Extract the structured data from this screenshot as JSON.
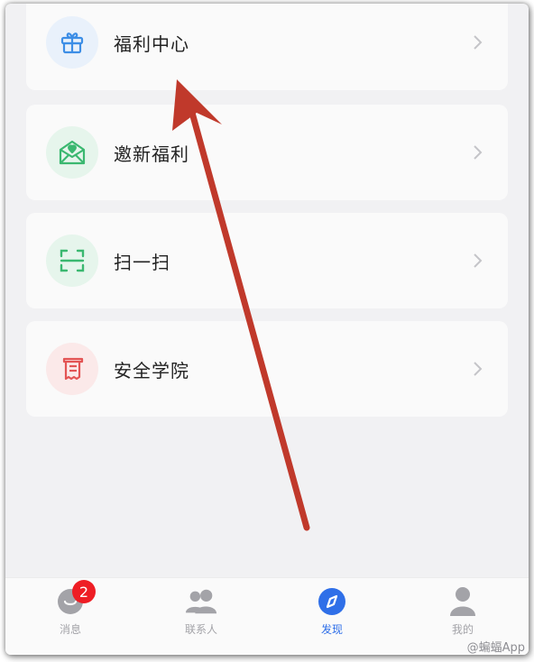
{
  "menu": {
    "items": [
      {
        "label": "福利中心",
        "icon": "gift-icon",
        "bg": "#e9f1fb",
        "color": "#3d8ee6"
      },
      {
        "label": "邀新福利",
        "icon": "envelope-heart-icon",
        "bg": "#e6f5ec",
        "color": "#3bb870"
      },
      {
        "label": "扫一扫",
        "icon": "scan-icon",
        "bg": "#e6f5ec",
        "color": "#3bb870"
      },
      {
        "label": "安全学院",
        "icon": "receipt-icon",
        "bg": "#fbe9e9",
        "color": "#e35454"
      }
    ]
  },
  "tabbar": {
    "tabs": [
      {
        "label": "消息",
        "icon": "chat-bubble-icon",
        "badge": "2"
      },
      {
        "label": "联系人",
        "icon": "contacts-icon"
      },
      {
        "label": "发现",
        "icon": "compass-icon",
        "active": true
      },
      {
        "label": "我的",
        "icon": "person-icon"
      }
    ]
  },
  "watermark": "@蝙蝠App",
  "colors": {
    "accent": "#2f6fe8",
    "arrow": "#c0392b",
    "badge": "#ee1d24"
  }
}
